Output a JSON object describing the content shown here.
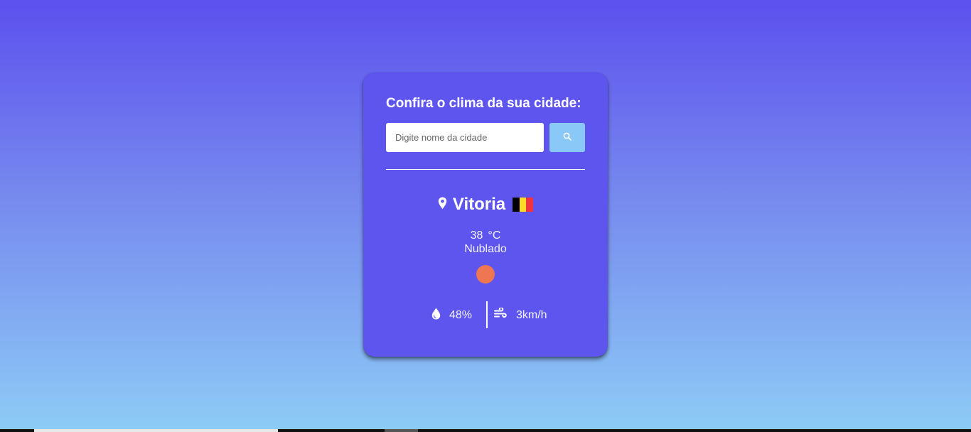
{
  "card": {
    "title": "Confira o clima da sua cidade:",
    "search": {
      "placeholder": "Digite nome da cidade",
      "value": "",
      "button_icon": "search-icon"
    },
    "location": {
      "icon": "map-pin-icon",
      "city": "Vitoria",
      "flag_icon": "belgium-flag-icon",
      "flag_colors": [
        "#000000",
        "#fdda24",
        "#ef3340"
      ]
    },
    "temperature": {
      "value": "38",
      "unit": "°C"
    },
    "description": "Nublado",
    "weather_icon": "weather-condition-icon",
    "weather_icon_color": "#ee7653",
    "humidity": {
      "icon": "droplet-icon",
      "value": "48%"
    },
    "wind": {
      "icon": "wind-icon",
      "value": "3km/h"
    }
  },
  "colors": {
    "card_background": "#5d55ee",
    "search_button": "#8ac9f7",
    "gradient_top": "#5c50ee",
    "gradient_bottom": "#8dccf6"
  }
}
